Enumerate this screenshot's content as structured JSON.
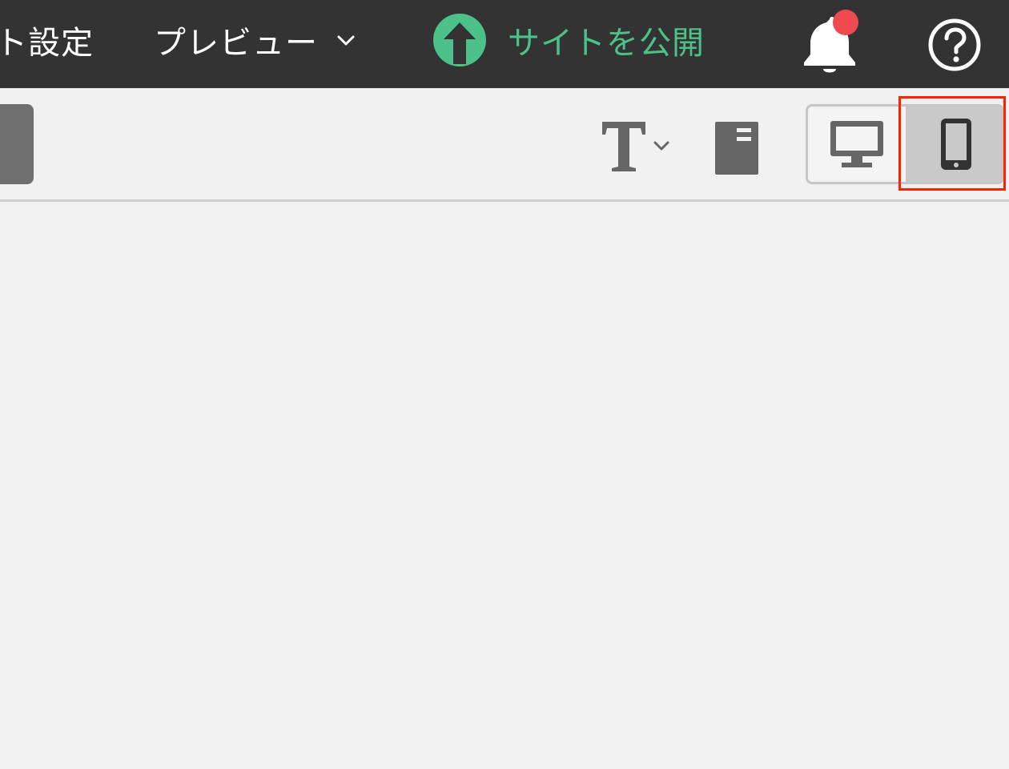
{
  "topbar": {
    "site_settings_label": "ト設定",
    "preview_label": "プレビュー",
    "publish_label": "サイトを公開",
    "notification_badge": true
  },
  "toolbar": {
    "font_icon": "T",
    "selected_device": "mobile"
  },
  "colors": {
    "topbar_bg": "#333333",
    "publish_green": "#4cc28a",
    "badge_red": "#ef4a4f",
    "highlight_red": "#ff2200",
    "icon_gray": "#666666"
  }
}
